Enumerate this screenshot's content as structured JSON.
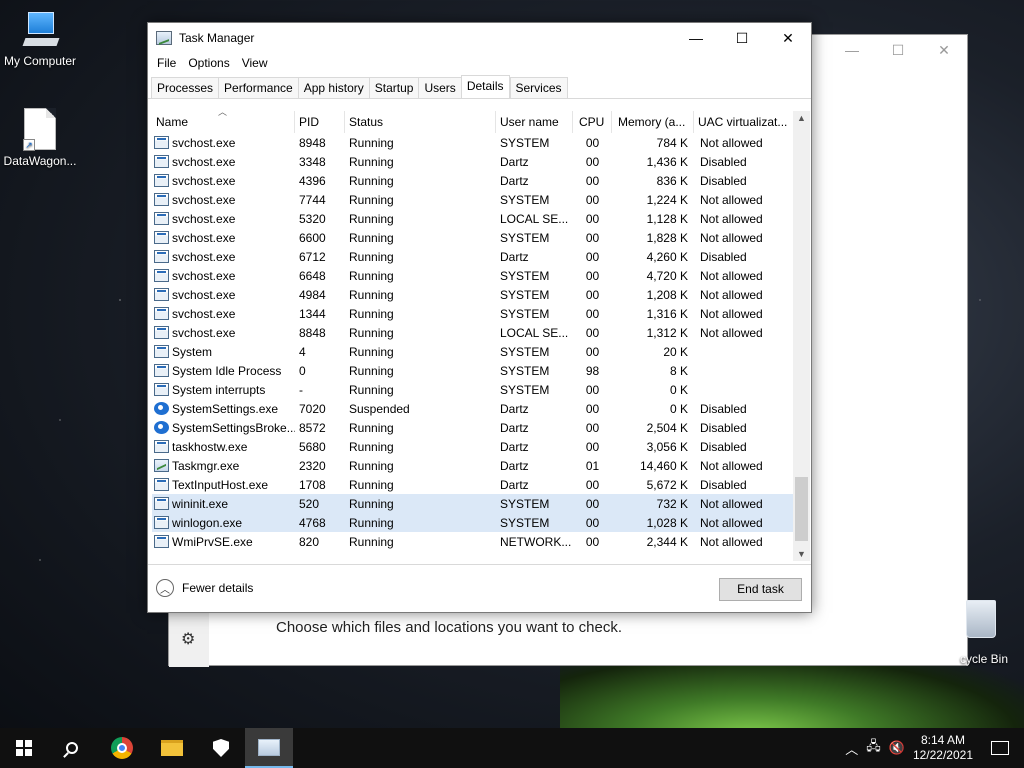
{
  "desktop": {
    "icons": [
      {
        "label": "My Computer"
      },
      {
        "label": "DataWagon..."
      }
    ],
    "recycle_label": "cycle Bin"
  },
  "bg_window": {
    "message": "Choose which files and locations you want to check."
  },
  "task_manager": {
    "title": "Task Manager",
    "menu": [
      "File",
      "Options",
      "View"
    ],
    "tabs": [
      "Processes",
      "Performance",
      "App history",
      "Startup",
      "Users",
      "Details",
      "Services"
    ],
    "active_tab": "Details",
    "columns": {
      "name": "Name",
      "pid": "PID",
      "status": "Status",
      "user": "User name",
      "cpu": "CPU",
      "mem": "Memory (a...",
      "uac": "UAC virtualizat..."
    },
    "rows": [
      {
        "name": "svchost.exe",
        "pid": "8948",
        "status": "Running",
        "user": "SYSTEM",
        "cpu": "00",
        "mem": "784 K",
        "uac": "Not allowed",
        "icon": "service-icon"
      },
      {
        "name": "svchost.exe",
        "pid": "3348",
        "status": "Running",
        "user": "Dartz",
        "cpu": "00",
        "mem": "1,436 K",
        "uac": "Disabled",
        "icon": "service-icon"
      },
      {
        "name": "svchost.exe",
        "pid": "4396",
        "status": "Running",
        "user": "Dartz",
        "cpu": "00",
        "mem": "836 K",
        "uac": "Disabled",
        "icon": "service-icon"
      },
      {
        "name": "svchost.exe",
        "pid": "7744",
        "status": "Running",
        "user": "SYSTEM",
        "cpu": "00",
        "mem": "1,224 K",
        "uac": "Not allowed",
        "icon": "service-icon"
      },
      {
        "name": "svchost.exe",
        "pid": "5320",
        "status": "Running",
        "user": "LOCAL SE...",
        "cpu": "00",
        "mem": "1,128 K",
        "uac": "Not allowed",
        "icon": "service-icon"
      },
      {
        "name": "svchost.exe",
        "pid": "6600",
        "status": "Running",
        "user": "SYSTEM",
        "cpu": "00",
        "mem": "1,828 K",
        "uac": "Not allowed",
        "icon": "service-icon"
      },
      {
        "name": "svchost.exe",
        "pid": "6712",
        "status": "Running",
        "user": "Dartz",
        "cpu": "00",
        "mem": "4,260 K",
        "uac": "Disabled",
        "icon": "service-icon"
      },
      {
        "name": "svchost.exe",
        "pid": "6648",
        "status": "Running",
        "user": "SYSTEM",
        "cpu": "00",
        "mem": "4,720 K",
        "uac": "Not allowed",
        "icon": "service-icon"
      },
      {
        "name": "svchost.exe",
        "pid": "4984",
        "status": "Running",
        "user": "SYSTEM",
        "cpu": "00",
        "mem": "1,208 K",
        "uac": "Not allowed",
        "icon": "service-icon"
      },
      {
        "name": "svchost.exe",
        "pid": "1344",
        "status": "Running",
        "user": "SYSTEM",
        "cpu": "00",
        "mem": "1,316 K",
        "uac": "Not allowed",
        "icon": "service-icon"
      },
      {
        "name": "svchost.exe",
        "pid": "8848",
        "status": "Running",
        "user": "LOCAL SE...",
        "cpu": "00",
        "mem": "1,312 K",
        "uac": "Not allowed",
        "icon": "service-icon"
      },
      {
        "name": "System",
        "pid": "4",
        "status": "Running",
        "user": "SYSTEM",
        "cpu": "00",
        "mem": "20 K",
        "uac": "",
        "icon": "service-icon"
      },
      {
        "name": "System Idle Process",
        "pid": "0",
        "status": "Running",
        "user": "SYSTEM",
        "cpu": "98",
        "mem": "8 K",
        "uac": "",
        "icon": "service-icon"
      },
      {
        "name": "System interrupts",
        "pid": "-",
        "status": "Running",
        "user": "SYSTEM",
        "cpu": "00",
        "mem": "0 K",
        "uac": "",
        "icon": "service-icon"
      },
      {
        "name": "SystemSettings.exe",
        "pid": "7020",
        "status": "Suspended",
        "user": "Dartz",
        "cpu": "00",
        "mem": "0 K",
        "uac": "Disabled",
        "icon": "gear-icon"
      },
      {
        "name": "SystemSettingsBroke...",
        "pid": "8572",
        "status": "Running",
        "user": "Dartz",
        "cpu": "00",
        "mem": "2,504 K",
        "uac": "Disabled",
        "icon": "gear-icon"
      },
      {
        "name": "taskhostw.exe",
        "pid": "5680",
        "status": "Running",
        "user": "Dartz",
        "cpu": "00",
        "mem": "3,056 K",
        "uac": "Disabled",
        "icon": "service-icon"
      },
      {
        "name": "Taskmgr.exe",
        "pid": "2320",
        "status": "Running",
        "user": "Dartz",
        "cpu": "01",
        "mem": "14,460 K",
        "uac": "Not allowed",
        "icon": "task-manager-icon"
      },
      {
        "name": "TextInputHost.exe",
        "pid": "1708",
        "status": "Running",
        "user": "Dartz",
        "cpu": "00",
        "mem": "5,672 K",
        "uac": "Disabled",
        "icon": "service-icon"
      },
      {
        "name": "wininit.exe",
        "pid": "520",
        "status": "Running",
        "user": "SYSTEM",
        "cpu": "00",
        "mem": "732 K",
        "uac": "Not allowed",
        "icon": "service-icon",
        "selected": true
      },
      {
        "name": "winlogon.exe",
        "pid": "4768",
        "status": "Running",
        "user": "SYSTEM",
        "cpu": "00",
        "mem": "1,028 K",
        "uac": "Not allowed",
        "icon": "service-icon",
        "selected": true
      },
      {
        "name": "WmiPrvSE.exe",
        "pid": "820",
        "status": "Running",
        "user": "NETWORK...",
        "cpu": "00",
        "mem": "2,344 K",
        "uac": "Not allowed",
        "icon": "service-icon"
      }
    ],
    "fewer_details": "Fewer details",
    "end_task": "End task"
  },
  "taskbar": {
    "time": "8:14 AM",
    "date": "12/22/2021"
  },
  "colors": {
    "selection": "#dbe8f7",
    "accent": "#76b9ed"
  }
}
